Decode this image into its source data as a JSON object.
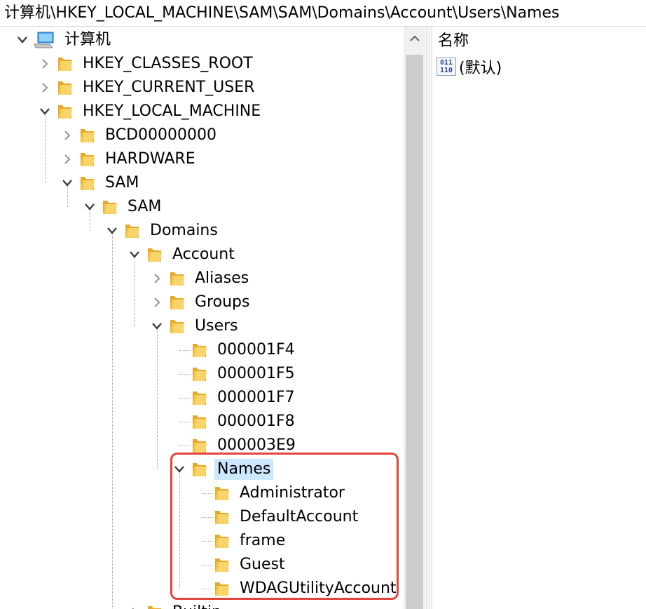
{
  "address": "计算机\\HKEY_LOCAL_MACHINE\\SAM\\SAM\\Domains\\Account\\Users\\Names",
  "tree": {
    "root": {
      "label": "计算机",
      "icon": "computer-icon",
      "expanded": true
    },
    "nodes": [
      {
        "label": "HKEY_CLASSES_ROOT",
        "state": "collapsed",
        "depth": 1
      },
      {
        "label": "HKEY_CURRENT_USER",
        "state": "collapsed",
        "depth": 1
      },
      {
        "label": "HKEY_LOCAL_MACHINE",
        "state": "expanded",
        "depth": 1
      },
      {
        "label": "BCD00000000",
        "state": "collapsed",
        "depth": 2
      },
      {
        "label": "HARDWARE",
        "state": "collapsed",
        "depth": 2
      },
      {
        "label": "SAM",
        "state": "expanded",
        "depth": 2
      },
      {
        "label": "SAM",
        "state": "expanded",
        "depth": 3
      },
      {
        "label": "Domains",
        "state": "expanded",
        "depth": 4
      },
      {
        "label": "Account",
        "state": "expanded",
        "depth": 5
      },
      {
        "label": "Aliases",
        "state": "collapsed",
        "depth": 6
      },
      {
        "label": "Groups",
        "state": "collapsed",
        "depth": 6
      },
      {
        "label": "Users",
        "state": "expanded",
        "depth": 6
      },
      {
        "label": "000001F4",
        "state": "leaf",
        "depth": 7
      },
      {
        "label": "000001F5",
        "state": "leaf",
        "depth": 7
      },
      {
        "label": "000001F7",
        "state": "leaf",
        "depth": 7
      },
      {
        "label": "000001F8",
        "state": "leaf",
        "depth": 7
      },
      {
        "label": "000003E9",
        "state": "leaf",
        "depth": 7
      },
      {
        "label": "Names",
        "state": "expanded",
        "depth": 7,
        "selected": true
      },
      {
        "label": "Administrator",
        "state": "leaf",
        "depth": 8
      },
      {
        "label": "DefaultAccount",
        "state": "leaf",
        "depth": 8
      },
      {
        "label": "frame",
        "state": "leaf",
        "depth": 8
      },
      {
        "label": "Guest",
        "state": "leaf",
        "depth": 8
      },
      {
        "label": "WDAGUtilityAccount",
        "state": "leaf",
        "depth": 8
      },
      {
        "label": "Builtin",
        "state": "collapsed",
        "depth": 5
      }
    ]
  },
  "values_pane": {
    "column_name": "名称",
    "rows": [
      {
        "icon": "reg-binary-icon",
        "name": "(默认)"
      }
    ]
  },
  "icon_glyph": {
    "binary_top": "011",
    "binary_bottom": "110"
  },
  "colors": {
    "selection": "#cce8ff",
    "highlight_box": "#e0463c",
    "folder_yellow": "#f5c542"
  }
}
